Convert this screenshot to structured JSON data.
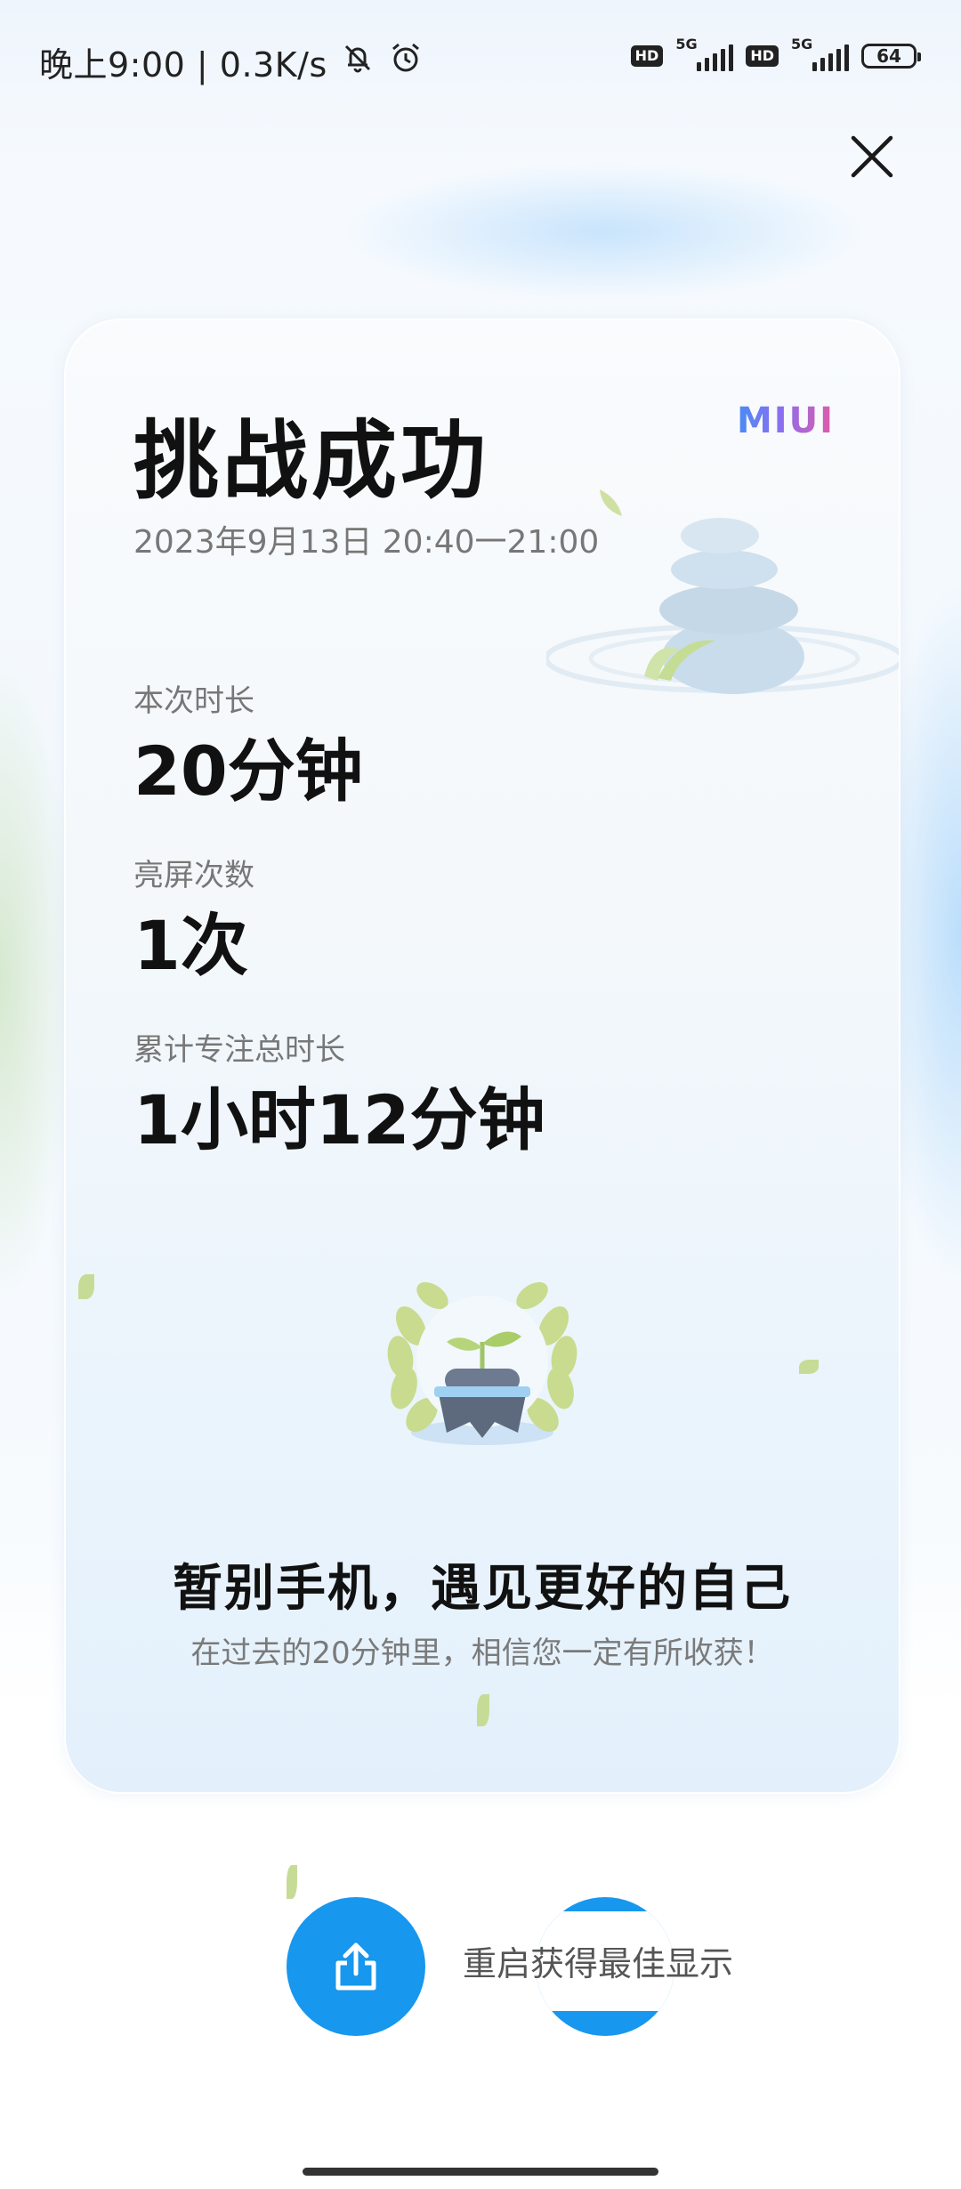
{
  "status_bar": {
    "time_speed": "晚上9:00 | 0.3K/s",
    "sim1_hd": "HD",
    "sim1_network": "5G",
    "sim2_hd": "HD",
    "sim2_network": "5G",
    "battery_level": "64",
    "icons": [
      "mute-bell-icon",
      "alarm-clock-icon",
      "signal-icon",
      "battery-icon"
    ]
  },
  "close_icon": "close-icon",
  "card": {
    "title": "挑战成功",
    "brand": "MIUI",
    "date_range": "2023年9月13日 20:40一21:00",
    "stats": [
      {
        "label": "本次时长",
        "value": "20分钟"
      },
      {
        "label": "亮屏次数",
        "value": "1次"
      },
      {
        "label": "累计专注总时长",
        "value": "1小时12分钟"
      }
    ],
    "slogan": "暂别手机，遇见更好的自己",
    "subtext": "在过去的20分钟里，相信您一定有所收获！"
  },
  "actions": {
    "share_icon": "share-icon",
    "restart_hint": "重启获得最佳显示"
  },
  "colors": {
    "accent": "#1797ee",
    "brand_gradient": [
      "#4a8cf5",
      "#8a6ff0",
      "#e15aa8"
    ],
    "leaf_green": "#c6dc96"
  }
}
